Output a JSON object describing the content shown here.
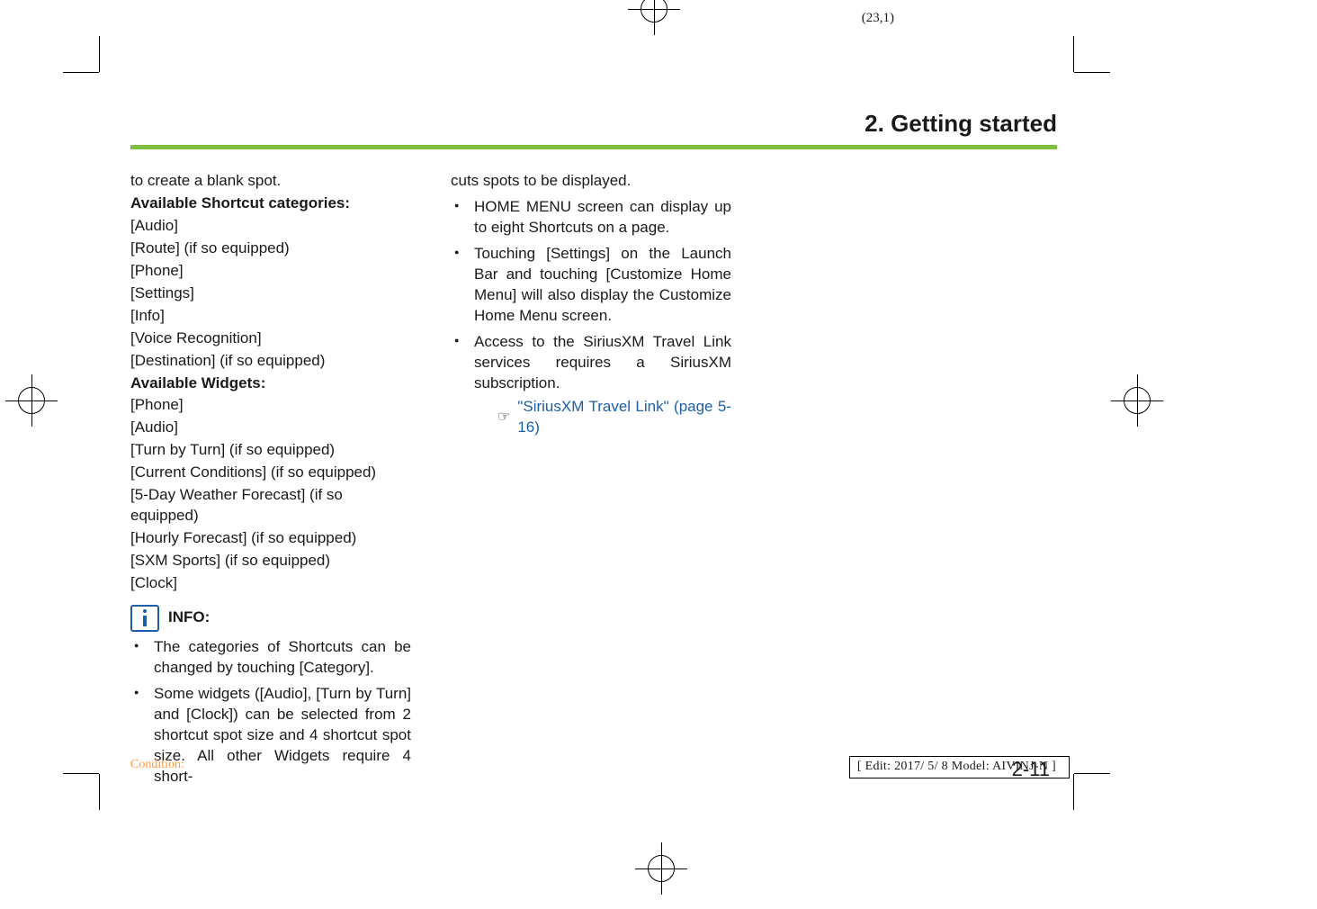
{
  "coord": "(23,1)",
  "chapter_title": "2. Getting started",
  "col1": {
    "lead_in": "to create a blank spot.",
    "shortcut_heading": "Available Shortcut categories:",
    "shortcuts": [
      "[Audio]",
      "[Route] (if so equipped)",
      "[Phone]",
      "[Settings]",
      "[Info]",
      "[Voice Recognition]",
      "[Destination] (if so equipped)"
    ],
    "widgets_heading": "Available Widgets:",
    "widgets": [
      "[Phone]",
      "[Audio]",
      "[Turn by Turn] (if so equipped)",
      "[Current Conditions] (if so equipped)",
      "[5-Day Weather Forecast] (if so equipped)",
      "[Hourly Forecast] (if so equipped)",
      "[SXM Sports] (if so equipped)",
      "[Clock]"
    ],
    "info_label": "INFO:",
    "info_bullets": [
      "The categories of Shortcuts can be changed by touching [Category].",
      "Some widgets ([Audio], [Turn by Turn] and [Clock]) can be selected from 2 shortcut spot size and 4 shortcut spot size. All other Widgets require 4 short-"
    ]
  },
  "col2": {
    "cont": "cuts spots to be displayed.",
    "bullets": [
      "HOME MENU screen can display up to eight Shortcuts on a page.",
      "Touching [Settings] on the Launch Bar and touching [Customize Home Menu] will also display the Customize Home Menu screen.",
      "Access to the SiriusXM Travel Link services requires a SiriusXM subscription."
    ],
    "crossref_text": "\"SiriusXM Travel Link\" (page 5-16)"
  },
  "page_number": "2-11",
  "footer_condition": "Condition:",
  "footer_edit": "[ Edit: 2017/ 5/ 8   Model: AIVINJ-N ]"
}
